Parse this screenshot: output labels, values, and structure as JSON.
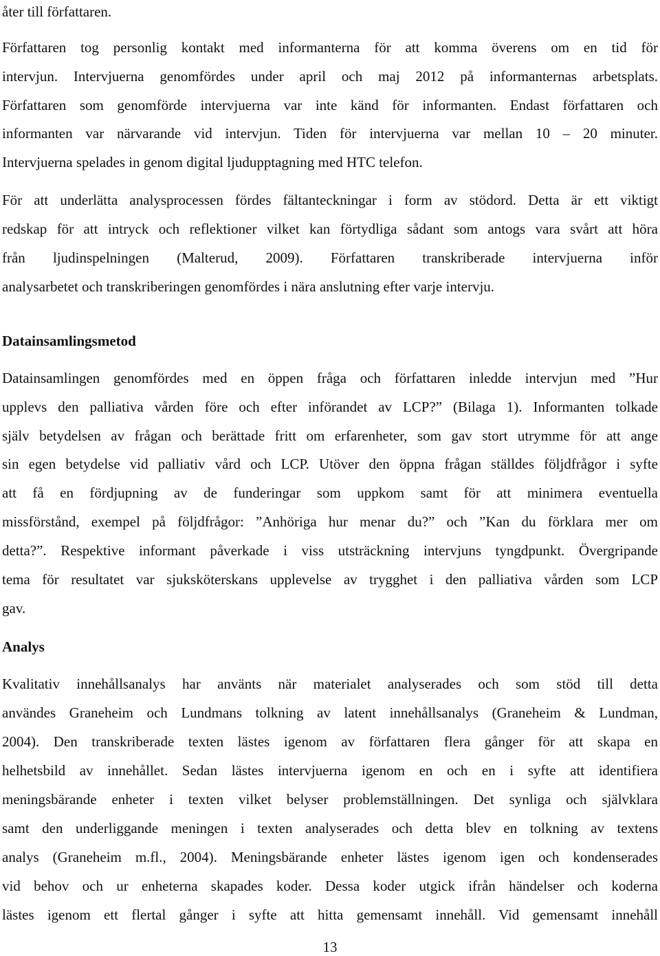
{
  "document": {
    "page_number": "13",
    "blocks": [
      {
        "type": "paragraph",
        "lines": [
          {
            "text": "åter till författaren.",
            "justify": false
          }
        ]
      },
      {
        "type": "paragraph",
        "lines": [
          {
            "text": "Författaren tog personlig kontakt med informanterna för att komma överens om en tid för",
            "justify": true
          },
          {
            "text": "intervjun. Intervjuerna genomfördes under april och maj 2012 på informanternas arbetsplats.",
            "justify": true
          },
          {
            "text": "Författaren som genomförde intervjuerna var inte känd för informanten. Endast författaren och",
            "justify": true
          },
          {
            "text": "informanten var närvarande vid intervjun. Tiden för intervjuerna var mellan 10 – 20 minuter.",
            "justify": true
          },
          {
            "text": "Intervjuerna spelades in genom digital ljudupptagning med HTC telefon.",
            "justify": false
          }
        ]
      },
      {
        "type": "paragraph",
        "lines": [
          {
            "text": "För att underlätta analysprocessen fördes fältanteckningar i form av stödord. Detta är ett viktigt",
            "justify": true
          },
          {
            "text": "redskap för att intryck och reflektioner vilket kan förtydliga sådant som antogs vara svårt att höra",
            "justify": true
          },
          {
            "text": "från ljudinspelningen (Malterud, 2009). Författaren transkriberade intervjuerna inför",
            "justify": true
          },
          {
            "text": "analysarbetet och transkriberingen genomfördes i nära anslutning efter varje intervju.",
            "justify": false
          }
        ]
      },
      {
        "type": "heading",
        "text": "Datainsamlingsmetod"
      },
      {
        "type": "paragraph",
        "lines": [
          {
            "text": "Datainsamlingen genomfördes med en öppen fråga och författaren inledde intervjun med ”Hur",
            "justify": true
          },
          {
            "text": "upplevs den palliativa vården före och efter införandet av LCP?” (Bilaga 1). Informanten tolkade",
            "justify": true
          },
          {
            "text": "själv betydelsen av frågan och berättade fritt om erfarenheter, som gav stort utrymme för att ange",
            "justify": true
          },
          {
            "text": "sin egen betydelse vid palliativ vård och LCP. Utöver den öppna frågan ställdes följdfrågor i syfte",
            "justify": true
          },
          {
            "text": "att få en fördjupning av de funderingar som uppkom samt för att minimera eventuella",
            "justify": true
          },
          {
            "text": "missförstånd, exempel på följdfrågor: ”Anhöriga hur menar du?” och ”Kan du förklara mer om",
            "justify": true
          },
          {
            "text": "detta?”. Respektive informant påverkade i viss utsträckning intervjuns tyngdpunkt. Övergripande",
            "justify": true
          },
          {
            "text": "tema för resultatet var sjuksköterskans upplevelse av trygghet i den palliativa vården som LCP",
            "justify": true
          },
          {
            "text": "gav.",
            "justify": false
          }
        ]
      },
      {
        "type": "heading",
        "text": "Analys"
      },
      {
        "type": "paragraph",
        "lines": [
          {
            "text": "Kvalitativ innehållsanalys har använts när materialet analyserades och som stöd till detta",
            "justify": true
          },
          {
            "text": "användes Graneheim och Lundmans tolkning av latent innehållsanalys (Graneheim & Lundman,",
            "justify": true
          },
          {
            "text": "2004). Den transkriberade texten lästes igenom av författaren flera gånger för att skapa en",
            "justify": true
          },
          {
            "text": "helhetsbild av innehållet. Sedan lästes intervjuerna igenom en och en i syfte att identifiera",
            "justify": true
          },
          {
            "text": "meningsbärande enheter i texten vilket belyser problemställningen. Det synliga och självklara",
            "justify": true
          },
          {
            "text": "samt den underliggande meningen i texten analyserades och detta blev en tolkning av textens",
            "justify": true
          },
          {
            "text": "analys (Graneheim m.fl., 2004). Meningsbärande enheter lästes igenom igen och kondenserades",
            "justify": true
          },
          {
            "text": "vid behov och ur enheterna skapades koder. Dessa koder utgick ifrån händelser och koderna",
            "justify": true
          },
          {
            "text": "lästes igenom ett flertal gånger i syfte att hitta gemensamt innehåll. Vid gemensamt innehåll",
            "justify": true
          }
        ]
      }
    ]
  }
}
